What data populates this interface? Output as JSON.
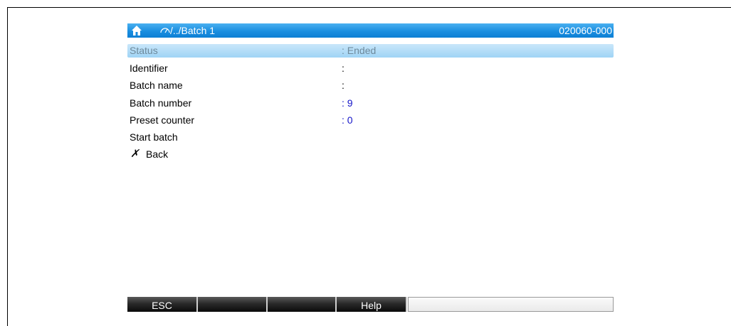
{
  "header": {
    "path": "/../Batch 1",
    "code": "020060-000",
    "home_icon": "home-icon",
    "dial_icon": "dial-icon"
  },
  "menu": {
    "items": [
      {
        "label": "Status",
        "value": ": Ended",
        "selected": true
      },
      {
        "label": "Identifier",
        "value": ":"
      },
      {
        "label": "Batch name",
        "value": ":"
      },
      {
        "label": "Batch number",
        "value": ": 9"
      },
      {
        "label": "Preset counter",
        "value": ": 0"
      },
      {
        "label": "Start batch",
        "value": ""
      },
      {
        "label": "Back",
        "value": "",
        "icon": "✗"
      }
    ]
  },
  "softkeys": {
    "keys": [
      "ESC",
      "",
      "",
      "Help"
    ]
  },
  "colors": {
    "accent": "#1a8ee0",
    "value_blue": "#1414c8",
    "selected_bg": "#9fd4f5"
  }
}
